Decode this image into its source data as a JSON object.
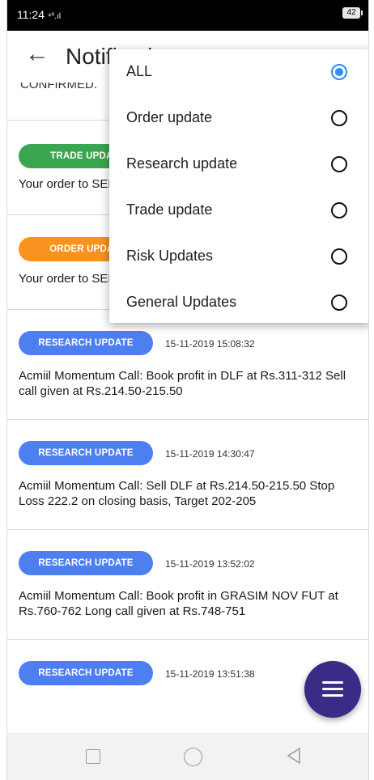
{
  "status_bar": {
    "time": "11:24",
    "network": "⁴⁰.ıl",
    "battery": "42"
  },
  "header": {
    "back_icon": "←",
    "title": "Notifications"
  },
  "list": {
    "partial_text": "CONFIRMED.",
    "items": [
      {
        "badge": "TRADE UPDATE",
        "badge_color": "#3aa64f",
        "timestamp": "",
        "message": "Your order to SELL"
      },
      {
        "badge": "ORDER UPDATE",
        "badge_color": "#f7931e",
        "timestamp": "",
        "message": "Your order to SELL"
      },
      {
        "badge": "RESEARCH UPDATE",
        "badge_color": "#4d7ff0",
        "timestamp": "15-11-2019 15:08:32",
        "message": "Acmiil Momentum Call: Book profit in DLF at Rs.311-312 Sell call given at Rs.214.50-215.50"
      },
      {
        "badge": "RESEARCH UPDATE",
        "badge_color": "#4d7ff0",
        "timestamp": "15-11-2019 14:30:47",
        "message": "Acmiil Momentum Call: Sell DLF at Rs.214.50-215.50 Stop Loss 222.2 on closing basis, Target 202-205"
      },
      {
        "badge": "RESEARCH UPDATE",
        "badge_color": "#4d7ff0",
        "timestamp": "15-11-2019 13:52:02",
        "message": "Acmiil Momentum Call: Book profit in GRASIM NOV FUT at Rs.760-762 Long call given at Rs.748-751"
      },
      {
        "badge": "RESEARCH UPDATE",
        "badge_color": "#4d7ff0",
        "timestamp": "15-11-2019 13:51:38",
        "message": ""
      }
    ]
  },
  "filter_menu": {
    "selected": "ALL",
    "options": [
      {
        "label": "ALL",
        "selected": true
      },
      {
        "label": "Order update",
        "selected": false
      },
      {
        "label": "Research update",
        "selected": false
      },
      {
        "label": "Trade update",
        "selected": false
      },
      {
        "label": "Risk Updates",
        "selected": false
      },
      {
        "label": "General Updates",
        "selected": false
      }
    ]
  },
  "fab": {
    "icon": "menu-icon",
    "color": "#3b2a86"
  },
  "nav_bar": {
    "icons": [
      "recents-icon",
      "home-icon",
      "back-triangle-icon"
    ]
  },
  "colors": {
    "accent_radio": "#2f8df0",
    "green": "#3aa64f",
    "orange": "#f7931e",
    "blue": "#4d7ff0"
  }
}
